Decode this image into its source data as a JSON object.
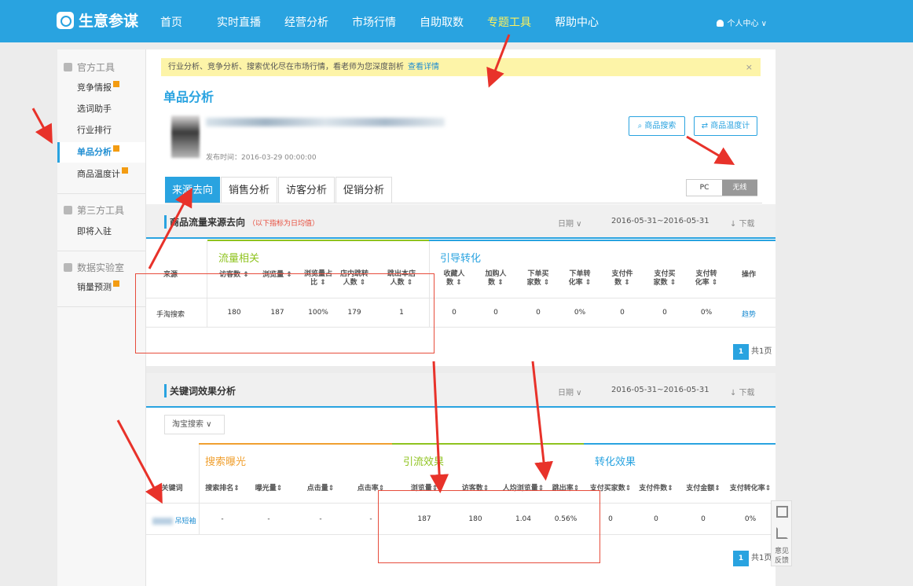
{
  "header": {
    "logo_text": "生意参谋",
    "nav": [
      "首页",
      "实时直播",
      "经营分析",
      "市场行情",
      "自助取数",
      "专题工具",
      "帮助中心"
    ],
    "active_nav": "专题工具",
    "user_label": "个人中心 ∨"
  },
  "sidebar": {
    "sections": [
      {
        "label": "官方工具",
        "items": [
          {
            "label": "竞争情报"
          },
          {
            "label": "选词助手"
          },
          {
            "label": "行业排行"
          },
          {
            "label": "单品分析"
          },
          {
            "label": "商品温度计"
          }
        ]
      },
      {
        "label": "第三方工具",
        "items": [
          {
            "label": "即将入驻"
          }
        ]
      },
      {
        "label": "数据实验室",
        "items": [
          {
            "label": "销量预测"
          }
        ]
      }
    ],
    "active_item": "单品分析"
  },
  "notice": {
    "text": "行业分析、竞争分析、搜索优化尽在市场行情，看老师为您深度剖析",
    "link": "查看详情",
    "close": "×"
  },
  "page_title": "单品分析",
  "product": {
    "publish_time": "发布时间：2016-03-29 00:00:00"
  },
  "buttons": {
    "search": "商品搜索",
    "thermometer": "商品温度计"
  },
  "tabs": [
    "来源去向",
    "销售分析",
    "访客分析",
    "促销分析"
  ],
  "device_toggle": {
    "pc": "PC",
    "wireless": "无线",
    "selected": "无线"
  },
  "traffic": {
    "title": "商品流量来源去向",
    "subtitle": "（以下指标为日均值）",
    "date_label": "日期 ∨",
    "date_range": "2016-05-31~2016-05-31",
    "download": "↓ 下载",
    "group1": "流量相关",
    "group2": "引导转化",
    "headers": [
      [
        "来源"
      ],
      [
        "访客数 ⇕"
      ],
      [
        "浏览量 ⇕"
      ],
      [
        "浏览量占",
        "比 ⇕"
      ],
      [
        "店内跳转",
        "人数 ⇕"
      ],
      [
        "跳出本店",
        "人数 ⇕"
      ],
      [
        "收藏人",
        "数 ⇕"
      ],
      [
        "加购人",
        "数 ⇕"
      ],
      [
        "下单买",
        "家数 ⇕"
      ],
      [
        "下单转",
        "化率 ⇕"
      ],
      [
        "支付件",
        "数 ⇕"
      ],
      [
        "支付买",
        "家数 ⇕"
      ],
      [
        "支付转",
        "化率 ⇕"
      ],
      [
        "操作"
      ]
    ],
    "row": [
      "手淘搜索",
      "180",
      "187",
      "100%",
      "179",
      "1",
      "0",
      "0",
      "0",
      "0%",
      "0",
      "0",
      "0%",
      "趋势"
    ],
    "pager_page": "1",
    "pager_total": "共1页"
  },
  "keywords": {
    "title": "关键词效果分析",
    "date_label": "日期 ∨",
    "date_range": "2016-05-31~2016-05-31",
    "download": "↓ 下载",
    "select": "淘宝搜索 ∨",
    "group1": "搜索曝光",
    "group2": "引流效果",
    "group3": "转化效果",
    "headers": [
      "关键词",
      "搜索排名⇕",
      "曝光量⇕",
      "点击量⇕",
      "点击率⇕",
      "浏览量⇕",
      "访客数⇕",
      "人均浏览量⇕",
      "跳出率⇕",
      "支付买家数⇕",
      "支付件数⇕",
      "支付金额⇕",
      "支付转化率⇕"
    ],
    "row": [
      "吊短袖",
      "-",
      "-",
      "-",
      "-",
      "187",
      "180",
      "1.04",
      "0.56%",
      "0",
      "0",
      "0",
      "0%"
    ],
    "pager_page": "1",
    "pager_total": "共1页"
  },
  "float_bar": {
    "feedback": "意见反馈"
  }
}
